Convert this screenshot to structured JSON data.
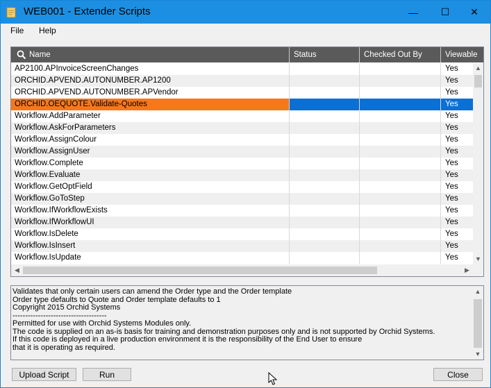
{
  "window": {
    "title": "WEB001 - Extender Scripts",
    "controls": {
      "minimize": "—",
      "maximize": "☐",
      "close": "✕"
    }
  },
  "menu": {
    "items": [
      {
        "label": "File"
      },
      {
        "label": "Help"
      }
    ]
  },
  "grid": {
    "columns": [
      "Name",
      "Status",
      "Checked Out By",
      "Viewable"
    ],
    "selected_index": 3,
    "rows": [
      {
        "name": "AP2100.APInvoiceScreenChanges",
        "status": "",
        "checked_out_by": "",
        "viewable": "Yes"
      },
      {
        "name": "ORCHID.APVEND.AUTONUMBER.AP1200",
        "status": "",
        "checked_out_by": "",
        "viewable": "Yes"
      },
      {
        "name": "ORCHID.APVEND.AUTONUMBER.APVendor",
        "status": "",
        "checked_out_by": "",
        "viewable": "Yes"
      },
      {
        "name": "ORCHID.OEQUOTE.Validate-Quotes",
        "status": "",
        "checked_out_by": "",
        "viewable": "Yes"
      },
      {
        "name": "Workflow.AddParameter",
        "status": "",
        "checked_out_by": "",
        "viewable": "Yes"
      },
      {
        "name": "Workflow.AskForParameters",
        "status": "",
        "checked_out_by": "",
        "viewable": "Yes"
      },
      {
        "name": "Workflow.AssignColour",
        "status": "",
        "checked_out_by": "",
        "viewable": "Yes"
      },
      {
        "name": "Workflow.AssignUser",
        "status": "",
        "checked_out_by": "",
        "viewable": "Yes"
      },
      {
        "name": "Workflow.Complete",
        "status": "",
        "checked_out_by": "",
        "viewable": "Yes"
      },
      {
        "name": "Workflow.Evaluate",
        "status": "",
        "checked_out_by": "",
        "viewable": "Yes"
      },
      {
        "name": "Workflow.GetOptField",
        "status": "",
        "checked_out_by": "",
        "viewable": "Yes"
      },
      {
        "name": "Workflow.GoToStep",
        "status": "",
        "checked_out_by": "",
        "viewable": "Yes"
      },
      {
        "name": "Workflow.IfWorkflowExists",
        "status": "",
        "checked_out_by": "",
        "viewable": "Yes"
      },
      {
        "name": "Workflow.IfWorkflowUI",
        "status": "",
        "checked_out_by": "",
        "viewable": "Yes"
      },
      {
        "name": "Workflow.IsDelete",
        "status": "",
        "checked_out_by": "",
        "viewable": "Yes"
      },
      {
        "name": "Workflow.IsInsert",
        "status": "",
        "checked_out_by": "",
        "viewable": "Yes"
      },
      {
        "name": "Workflow.IsUpdate",
        "status": "",
        "checked_out_by": "",
        "viewable": "Yes"
      }
    ]
  },
  "description": {
    "lines": [
      "Validates that only certain users can amend the Order type and the Order template",
      "Order type defaults to Quote and Order template defaults to 1",
      "Copyright 2015 Orchid Systems",
      "-------------------------------------",
      "Permitted for use with Orchid Systems Modules only.",
      "The code is supplied on an as-is basis for training and demonstration purposes only and is not supported by Orchid Systems.",
      "If this code is deployed in a live production environment it is the responsibility of the End User to ensure",
      "that it is operating as required."
    ]
  },
  "buttons": {
    "upload": "Upload Script",
    "run": "Run",
    "close": "Close"
  },
  "colors": {
    "titlebar": "#1d8fe2",
    "header": "#5a5a5a",
    "selected_name": "#f5781e",
    "selected_row": "#0d6fd2"
  }
}
